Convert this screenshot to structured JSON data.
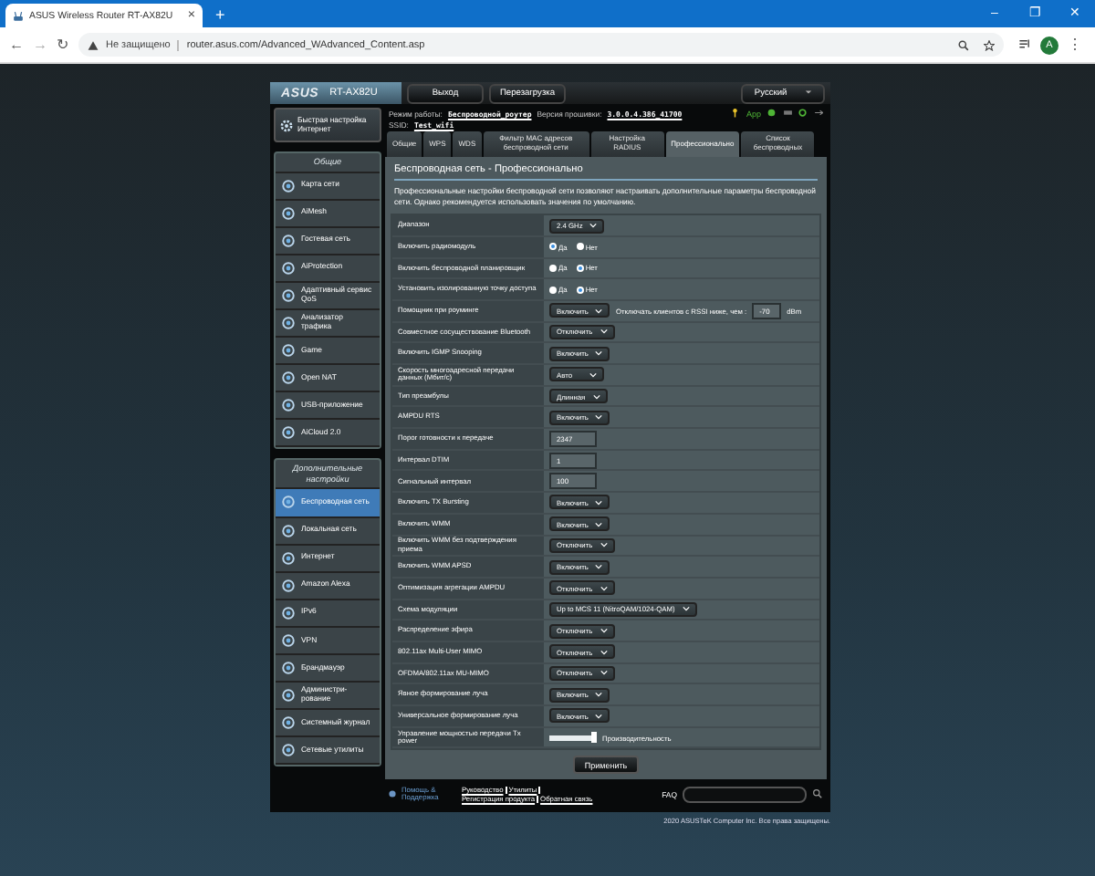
{
  "browser": {
    "tab_title": "ASUS Wireless Router RT-AX82U",
    "tab_close": "×",
    "new_tab": "+",
    "window_controls": [
      "–",
      "❐",
      "✕"
    ],
    "nav": [
      "←",
      "→",
      "↻"
    ],
    "security": "Не защищено",
    "url": "router.asus.com/Advanced_WAdvanced_Content.asp",
    "avatar": "A",
    "menu": "⋮"
  },
  "header": {
    "logo": "ASUS",
    "model": "RT-AX82U",
    "buttons": [
      "Выход",
      "Перезагрузка"
    ],
    "language": "Русский"
  },
  "status": {
    "mode_label": "Режим работы:",
    "mode": "Беспроводной_роутер",
    "firmware_label": "Версия прошивки:",
    "firmware": "3.0.0.4.386_41700",
    "ssid_label": "SSID:",
    "ssid": "Test_wifi",
    "app": "App"
  },
  "sidebar": {
    "quick": "Быстрая настройка Интернет",
    "sections": [
      {
        "title": "Общие",
        "items": [
          {
            "label": "Карта сети",
            "selected": false
          },
          {
            "label": "AiMesh",
            "selected": false
          },
          {
            "label": "Гостевая сеть",
            "selected": false
          },
          {
            "label": "AiProtection",
            "selected": false
          },
          {
            "label": "Адаптивный сервис QoS",
            "selected": false
          },
          {
            "label": "Анализатор трафика",
            "selected": false
          },
          {
            "label": "Game",
            "selected": false
          },
          {
            "label": "Open NAT",
            "selected": false
          },
          {
            "label": "USB-приложение",
            "selected": false
          },
          {
            "label": "AiCloud 2.0",
            "selected": false
          }
        ]
      },
      {
        "title": "Дополнительные настройки",
        "items": [
          {
            "label": "Беспроводная сеть",
            "selected": true
          },
          {
            "label": "Локальная сеть",
            "selected": false
          },
          {
            "label": "Интернет",
            "selected": false
          },
          {
            "label": "Amazon Alexa",
            "selected": false
          },
          {
            "label": "IPv6",
            "selected": false
          },
          {
            "label": "VPN",
            "selected": false
          },
          {
            "label": "Брандмауэр",
            "selected": false
          },
          {
            "label": "Администри-рование",
            "selected": false
          },
          {
            "label": "Системный журнал",
            "selected": false
          },
          {
            "label": "Сетевые утилиты",
            "selected": false
          }
        ]
      }
    ]
  },
  "tabs": [
    {
      "label": "Общие",
      "selected": false
    },
    {
      "label": "WPS",
      "selected": false
    },
    {
      "label": "WDS",
      "selected": false
    },
    {
      "label": "Фильтр MAC адресов беспроводной сети",
      "selected": false
    },
    {
      "label": "Настройка RADIUS",
      "selected": false
    },
    {
      "label": "Профессионально",
      "selected": true
    },
    {
      "label": "Список беспроводных",
      "selected": false
    }
  ],
  "content": {
    "title": "Беспроводная сеть - Профессионально",
    "description": "Профессиональные настройки беспроводной сети позволяют настраивать дополнительные параметры беспроводной сети. Однако рекомендуется использовать значения по умолчанию.",
    "rows": [
      {
        "kind": "select",
        "label": "Диапазон",
        "value": "2.4 GHz"
      },
      {
        "kind": "radio",
        "label": "Включить радиомодуль",
        "options": [
          {
            "label": "Да",
            "selected": true
          },
          {
            "label": "Нет",
            "selected": false
          }
        ]
      },
      {
        "kind": "radio",
        "label": "Включить беспроводной планировщик",
        "options": [
          {
            "label": "Да",
            "selected": false
          },
          {
            "label": "Нет",
            "selected": true
          }
        ]
      },
      {
        "kind": "radio",
        "label": "Установить изолированную точку доступа",
        "options": [
          {
            "label": "Да",
            "selected": false
          },
          {
            "label": "Нет",
            "selected": true
          }
        ]
      },
      {
        "kind": "roaming",
        "label": "Помощник при роуминге",
        "value": "Включить",
        "note": "Отключать клиентов с RSSI ниже, чем :",
        "threshold": "-70",
        "unit": "dBm"
      },
      {
        "kind": "select",
        "label": "Совместное сосуществование Bluetooth",
        "value": "Отключить"
      },
      {
        "kind": "select",
        "label": "Включить IGMP Snooping",
        "value": "Включить"
      },
      {
        "kind": "select",
        "label": "Скорость многоадресной передачи данных (Мбит/с)",
        "value": "Авто"
      },
      {
        "kind": "select",
        "label": "Тип преамбулы",
        "value": "Длинная"
      },
      {
        "kind": "select",
        "label": "AMPDU RTS",
        "value": "Включить"
      },
      {
        "kind": "input",
        "label": "Порог готовности к передаче",
        "value": "2347"
      },
      {
        "kind": "input",
        "label": "Интервал DTIM",
        "value": "1"
      },
      {
        "kind": "input",
        "label": "Сигнальный интервал",
        "value": "100"
      },
      {
        "kind": "select",
        "label": "Включить TX Bursting",
        "value": "Включить"
      },
      {
        "kind": "select",
        "label": "Включить WMM",
        "value": "Включить"
      },
      {
        "kind": "select",
        "label": "Включить WMM без подтверждения приема",
        "value": "Отключить"
      },
      {
        "kind": "select",
        "label": "Включить WMM APSD",
        "value": "Включить"
      },
      {
        "kind": "select",
        "label": "Оптимизация агрегации AMPDU",
        "value": "Отключить"
      },
      {
        "kind": "select",
        "label": "Схема модуляции",
        "value": "Up to MCS 11 (NitroQAM/1024-QAM)"
      },
      {
        "kind": "select",
        "label": "Распределение эфира",
        "value": "Отключить"
      },
      {
        "kind": "select",
        "label": "802.11ax Multi-User MIMO",
        "value": "Отключить"
      },
      {
        "kind": "select",
        "label": "OFDMA/802.11ax MU-MIMO",
        "value": "Отключить"
      },
      {
        "kind": "select",
        "label": "Явное формирование луча",
        "value": "Включить"
      },
      {
        "kind": "select",
        "label": "Универсальное формирование луча",
        "value": "Включить"
      },
      {
        "kind": "slider",
        "label": "Управление мощностью передачи Tx power",
        "level": 0.95,
        "note": "Производительность"
      }
    ],
    "apply": "Применить"
  },
  "footer": {
    "help": "Помощь & Поддержка",
    "links": [
      "Руководство",
      "Утилиты",
      "Регистрация продукта",
      "Обратная связь"
    ],
    "faq": "FAQ",
    "copyright": "2020 ASUSTeK Computer Inc. Все права защищены."
  }
}
